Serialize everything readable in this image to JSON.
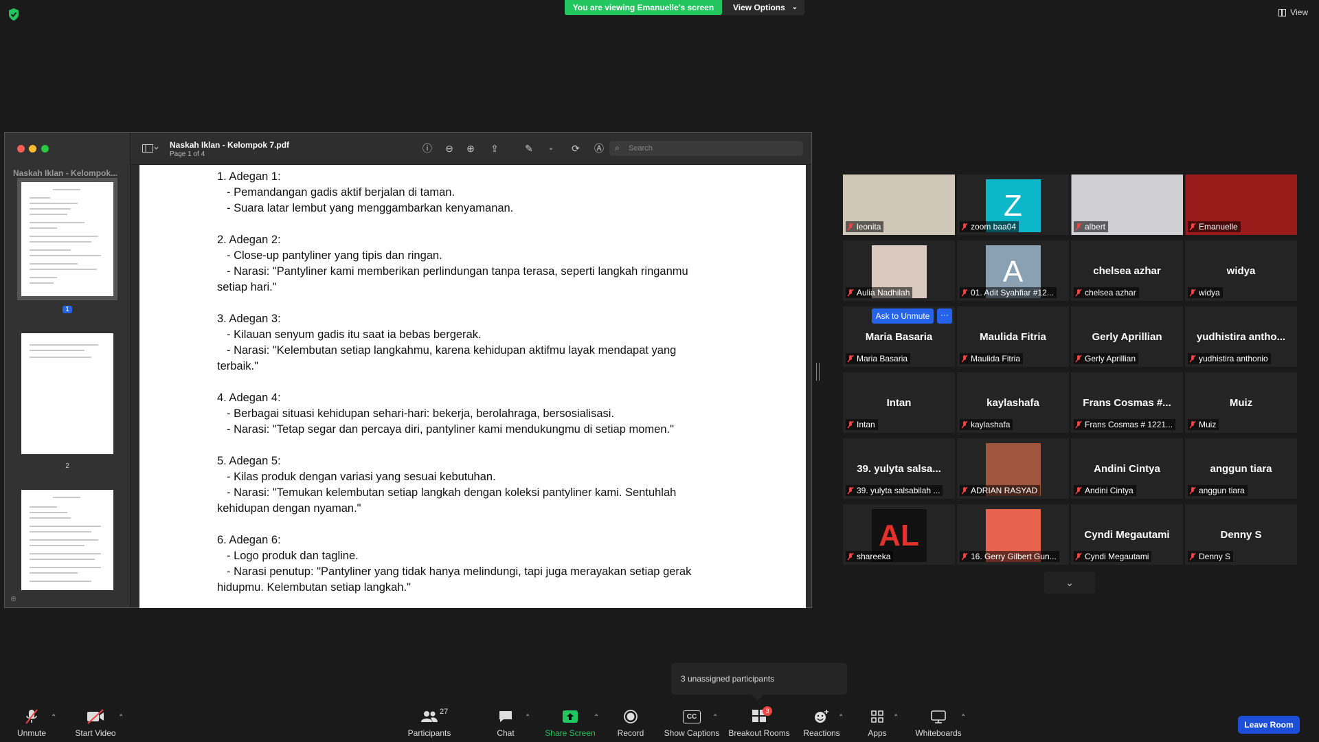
{
  "top": {
    "banner": "You are viewing Emanuelle's screen",
    "view_options": "View Options",
    "view": "View"
  },
  "pdf": {
    "title": "Naskah Iklan - Kelompok 7.pdf",
    "page_info": "Page 1 of 4",
    "sidebar_title": "Naskah Iklan - Kelompok...",
    "search_placeholder": "Search",
    "thumb_numbers": [
      "1",
      "2"
    ],
    "scenes": [
      {
        "head": "1. Adegan 1:",
        "lines": [
          "- Pemandangan gadis aktif berjalan di taman.",
          "- Suara latar lembut yang menggambarkan kenyamanan."
        ]
      },
      {
        "head": "2. Adegan 2:",
        "lines": [
          "- Close-up pantyliner yang tipis dan ringan.",
          "- Narasi: \"Pantyliner kami memberikan perlindungan tanpa terasa, seperti langkah ringanmu"
        ],
        "tail": "setiap hari.\""
      },
      {
        "head": "3. Adegan 3:",
        "lines": [
          "- Kilauan senyum gadis itu saat ia bebas bergerak.",
          "- Narasi: \"Kelembutan setiap langkahmu, karena kehidupan aktifmu layak mendapat yang"
        ],
        "tail": "terbaik.\""
      },
      {
        "head": "4. Adegan 4:",
        "lines": [
          "- Berbagai situasi kehidupan sehari-hari: bekerja, berolahraga, bersosialisasi.",
          "- Narasi: \"Tetap segar dan percaya diri, pantyliner kami mendukungmu di setiap momen.\""
        ]
      },
      {
        "head": "5. Adegan 5:",
        "lines": [
          "- Kilas produk dengan variasi yang sesuai kebutuhan.",
          "- Narasi: \"Temukan kelembutan setiap langkah dengan koleksi pantyliner kami. Sentuhlah"
        ],
        "tail": "kehidupan dengan nyaman.\""
      },
      {
        "head": "6. Adegan 6:",
        "lines": [
          "- Logo produk dan tagline.",
          "- Narasi penutup: \"Pantyliner yang tidak hanya melindungi, tapi juga merayakan setiap gerak"
        ],
        "tail": "hidupmu. Kelembutan setiap langkah.\""
      }
    ]
  },
  "gallery": {
    "ask_to_unmute": "Ask to Unmute",
    "more": "···",
    "tiles": [
      {
        "label": "leonita",
        "kind": "video",
        "bg": "#cfc8b8"
      },
      {
        "label": "zoom baa04",
        "kind": "avatar",
        "letter": "Z",
        "bg": "#0bb7c8"
      },
      {
        "label": "albert",
        "kind": "video",
        "bg": "#cfcfd2"
      },
      {
        "label": "Emanuelle",
        "kind": "video",
        "bg": "#9b1b1b"
      },
      {
        "label": "Aulia Nadhilah",
        "kind": "video",
        "bg": "#d8c8bd"
      },
      {
        "label": "01. Adit Syahfiar #12...",
        "kind": "avatar",
        "letter": "A",
        "bg": "#8aa1b4"
      },
      {
        "name": "chelsea azhar",
        "label": "chelsea azhar"
      },
      {
        "name": "widya",
        "label": "widya"
      },
      {
        "name": "Maria Basaria",
        "label": "Maria Basaria"
      },
      {
        "name": "Maulida Fitria",
        "label": "Maulida Fitria"
      },
      {
        "name": "Gerly Aprillian",
        "label": "Gerly Aprillian"
      },
      {
        "name": "yudhistira antho...",
        "label": "yudhistira anthonio"
      },
      {
        "name": "Intan",
        "label": "Intan"
      },
      {
        "name": "kaylashafa",
        "label": "kaylashafa"
      },
      {
        "name": "Frans Cosmas #...",
        "label": "Frans Cosmas # 1221..."
      },
      {
        "name": "Muiz",
        "label": "Muiz"
      },
      {
        "name": "39. yulyta salsa...",
        "label": "39. yulyta salsabilah ..."
      },
      {
        "label": "ADRIAN RASYAD",
        "kind": "video",
        "bg": "#a0553d"
      },
      {
        "name": "Andini Cintya",
        "label": "Andini Cintya"
      },
      {
        "name": "anggun tiara",
        "label": "anggun tiara"
      },
      {
        "label": "shareeka",
        "kind": "logo",
        "letter": "AL",
        "bg": "#111"
      },
      {
        "label": "16. Gerry Gilbert Gun...",
        "kind": "video",
        "bg": "#e8624e"
      },
      {
        "name": "Cyndi Megautami",
        "label": "Cyndi Megautami"
      },
      {
        "name": "Denny S",
        "label": "Denny S"
      }
    ]
  },
  "popup": {
    "unassigned": "3 unassigned participants"
  },
  "toolbar": {
    "unmute": "Unmute",
    "start_video": "Start Video",
    "participants": "Participants",
    "participants_count": "27",
    "chat": "Chat",
    "share_screen": "Share Screen",
    "record": "Record",
    "show_captions": "Show Captions",
    "captions_glyph": "CC",
    "breakout_rooms": "Breakout Rooms",
    "breakout_badge": "3",
    "reactions": "Reactions",
    "apps": "Apps",
    "whiteboards": "Whiteboards",
    "leave_room": "Leave Room"
  },
  "colors": {
    "accent": "#22c55e",
    "primary": "#2563eb",
    "active_speaker": "#d9e34c",
    "muted": "#ef4444"
  }
}
